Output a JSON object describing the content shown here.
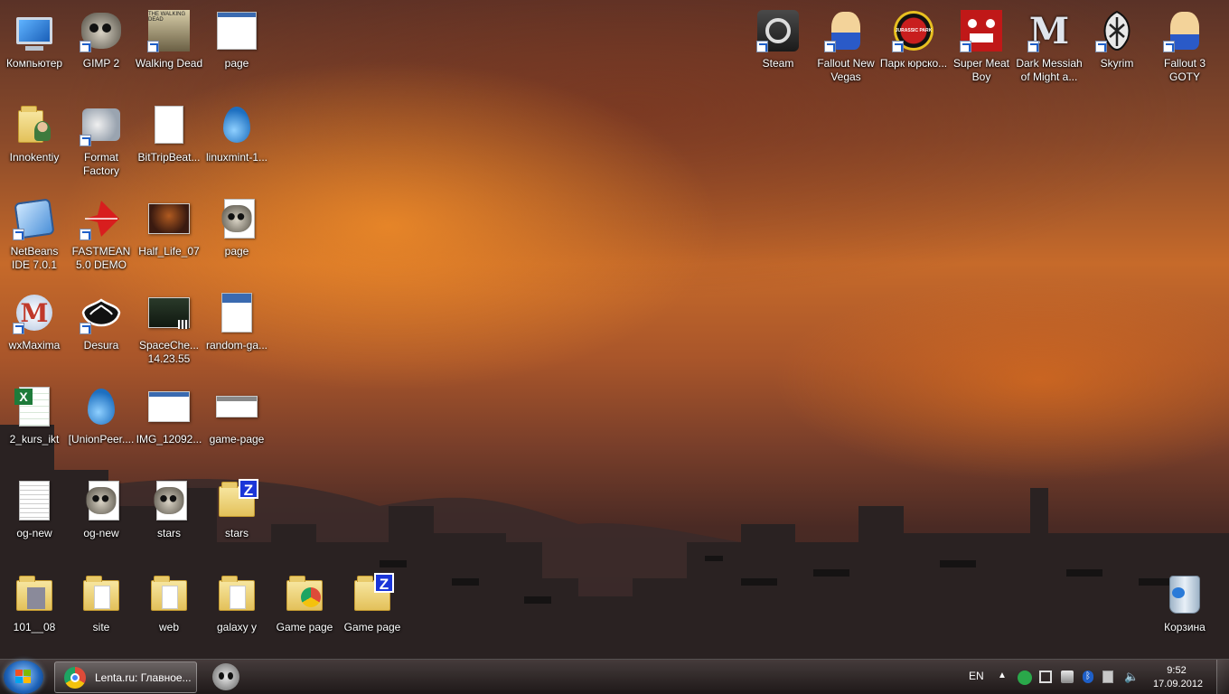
{
  "desktop": {
    "icons": [
      {
        "label": "Компьютер",
        "icon": "computer-icon"
      },
      {
        "label": "GIMP 2",
        "icon": "gimp-icon"
      },
      {
        "label": "Walking Dead",
        "icon": "walking-dead-icon",
        "art_text": "THE WALKING DEAD"
      },
      {
        "label": "page",
        "icon": "webpage-thumbnail-icon"
      },
      {
        "label": "Innokentiy",
        "icon": "user-folder-icon"
      },
      {
        "label": "Format Factory",
        "icon": "format-factory-icon"
      },
      {
        "label": "BitTripBeat...",
        "icon": "blank-file-icon"
      },
      {
        "label": "linuxmint-1...",
        "icon": "torrent-drop-icon"
      },
      {
        "label": "NetBeans IDE 7.0.1",
        "icon": "netbeans-icon"
      },
      {
        "label": "FASTMEAN 5.0 DEMO",
        "icon": "fastmean-icon"
      },
      {
        "label": "Half_Life_07",
        "icon": "image-thumbnail-icon"
      },
      {
        "label": "page",
        "icon": "gimp-file-icon"
      },
      {
        "label": "wxMaxima",
        "icon": "wxmaxima-icon"
      },
      {
        "label": "Desura",
        "icon": "desura-icon"
      },
      {
        "label": "SpaceChe... 14.23.55",
        "icon": "video-thumbnail-icon"
      },
      {
        "label": "random-ga...",
        "icon": "document-thumbnail-icon"
      },
      {
        "label": "2_kurs_ikt",
        "icon": "excel-icon"
      },
      {
        "label": "[UnionPeer....",
        "icon": "torrent-drop-icon"
      },
      {
        "label": "IMG_12092...",
        "icon": "screenshot-thumbnail-icon"
      },
      {
        "label": "game-page",
        "icon": "webpage-thumbnail-icon"
      },
      {
        "label": "og-new",
        "icon": "document-thumbnail-icon"
      },
      {
        "label": "og-new",
        "icon": "gimp-file-icon"
      },
      {
        "label": "stars",
        "icon": "gimp-file-icon"
      },
      {
        "label": "stars",
        "icon": "zip-folder-icon"
      },
      {
        "label": "101__08",
        "icon": "folder-icon"
      },
      {
        "label": "site",
        "icon": "folder-icon"
      },
      {
        "label": "web",
        "icon": "folder-icon"
      },
      {
        "label": "galaxy y",
        "icon": "folder-icon"
      },
      {
        "label": "Game page",
        "icon": "chrome-folder-icon"
      },
      {
        "label": "Game page",
        "icon": "zip-folder-icon"
      },
      {
        "label": "Steam",
        "icon": "steam-icon"
      },
      {
        "label": "Fallout New Vegas",
        "icon": "vault-boy-icon"
      },
      {
        "label": "Парк юрско...",
        "icon": "jurassic-park-icon",
        "art_text": "JURASSIC PARK"
      },
      {
        "label": "Super Meat Boy",
        "icon": "meat-boy-icon"
      },
      {
        "label": "Dark Messiah of Might a...",
        "icon": "dark-messiah-icon",
        "art_text": "M"
      },
      {
        "label": "Skyrim",
        "icon": "skyrim-icon"
      },
      {
        "label": "Fallout 3 GOTY",
        "icon": "vault-boy-icon"
      },
      {
        "label": "Корзина",
        "icon": "recycle-bin-icon"
      }
    ]
  },
  "taskbar": {
    "start_icon": "windows-start-icon",
    "tasks": [
      {
        "label": "Lenta.ru: Главное...",
        "icon": "chrome-icon"
      },
      {
        "label": "",
        "icon": "alienware-icon"
      }
    ],
    "tray": {
      "language": "EN",
      "arrow": "▲",
      "icons": [
        "kaspersky-icon",
        "network-icon",
        "action-center-icon",
        "bluetooth-icon",
        "power-icon",
        "volume-icon"
      ],
      "time": "9:52",
      "date": "17.09.2012"
    }
  }
}
